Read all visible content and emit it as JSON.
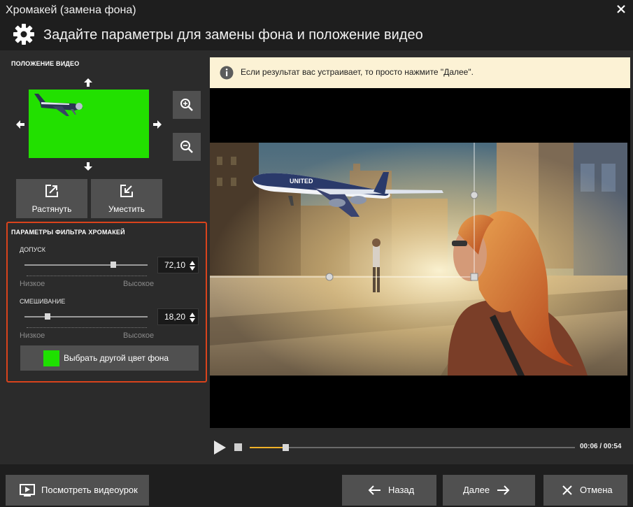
{
  "window": {
    "title": "Хромакей (замена фона)"
  },
  "header": {
    "text": "Задайте параметры для замены фона и положение видео",
    "icon": "gear-icon"
  },
  "position": {
    "title": "ПОЛОЖЕНИЕ ВИДЕО",
    "stretch_label": "Растянуть",
    "fit_label": "Уместить"
  },
  "filter": {
    "title": "ПАРАМЕТРЫ ФИЛЬТРА ХРОМАКЕЙ",
    "tolerance": {
      "label": "ДОПУСК",
      "value": "72,10",
      "level": 0.72,
      "low": "Низкое",
      "high": "Высокое"
    },
    "blending": {
      "label": "СМЕШИВАНИЕ",
      "value": "18,20",
      "level": 0.19,
      "low": "Низкое",
      "high": "Высокое"
    },
    "color_button_label": "Выбрать другой цвет фона",
    "key_color": "#1ee000"
  },
  "notice": {
    "text": "Если результат вас устраивает, то просто нажмите \"Далее\"."
  },
  "player": {
    "current_time": "00:06",
    "separator": " / ",
    "total_time": "00:54",
    "progress": 0.11
  },
  "footer": {
    "tutorial_label": "Посмотреть видеоурок",
    "back_label": "Назад",
    "next_label": "Далее",
    "cancel_label": "Отмена"
  },
  "colors": {
    "accent": "#d9431c",
    "progress": "#f0b128",
    "notice_bg": "#fcf2d5"
  }
}
